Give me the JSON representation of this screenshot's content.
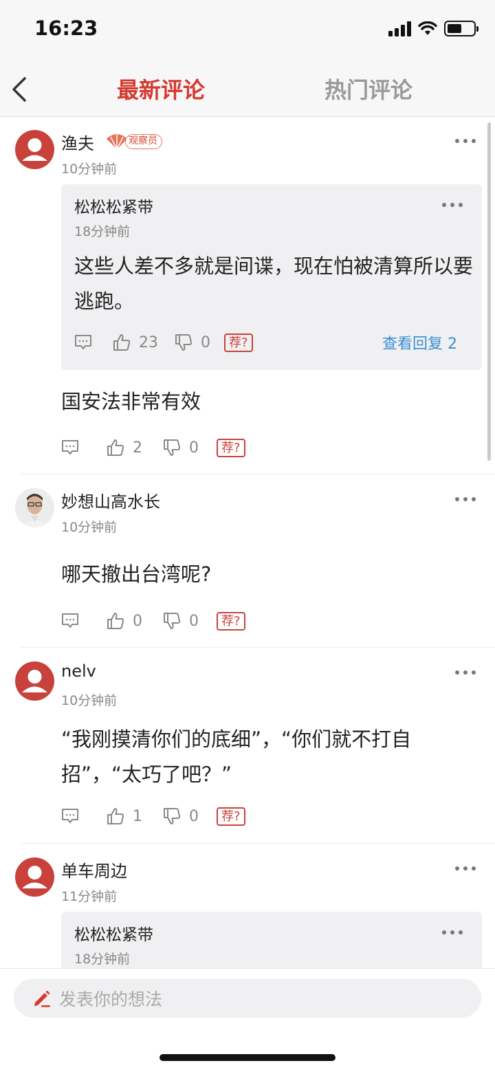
{
  "status_bar": {
    "time": "16:23",
    "battery_level": 0.55
  },
  "nav": {
    "back_icon": "chevron-left-icon",
    "tab_latest": "最新评论",
    "tab_hot": "热门评论"
  },
  "comments": [
    {
      "username": "渔夫",
      "badge": "观察员",
      "time": "10分钟前",
      "quote": {
        "username": "松松松紧带",
        "time": "18分钟前",
        "text": "这些人差不多就是间谍，现在怕被清算所以要逃跑。",
        "likes": "23",
        "dislikes": "0",
        "recommend": "荐?",
        "view_replies": "查看回复 2"
      },
      "text": "国安法非常有效",
      "likes": "2",
      "dislikes": "0",
      "recommend": "荐?"
    },
    {
      "username": "妙想山高水长",
      "time": "10分钟前",
      "text": "哪天撤出台湾呢?",
      "likes": "0",
      "dislikes": "0",
      "recommend": "荐?"
    },
    {
      "username": "nelv",
      "time": "10分钟前",
      "text": "“我刚摸清你们的底细”，“你们就不打自招”，“太巧了吧？”",
      "likes": "1",
      "dislikes": "0",
      "recommend": "荐?"
    },
    {
      "username": "单车周边",
      "time": "11分钟前",
      "quote": {
        "username": "松松松紧带",
        "time": "18分钟前"
      }
    }
  ],
  "input": {
    "placeholder": "发表你的想法"
  },
  "colors": {
    "accent": "#d43a2f",
    "link": "#3a8ed4",
    "avatar": "#c8413b"
  }
}
